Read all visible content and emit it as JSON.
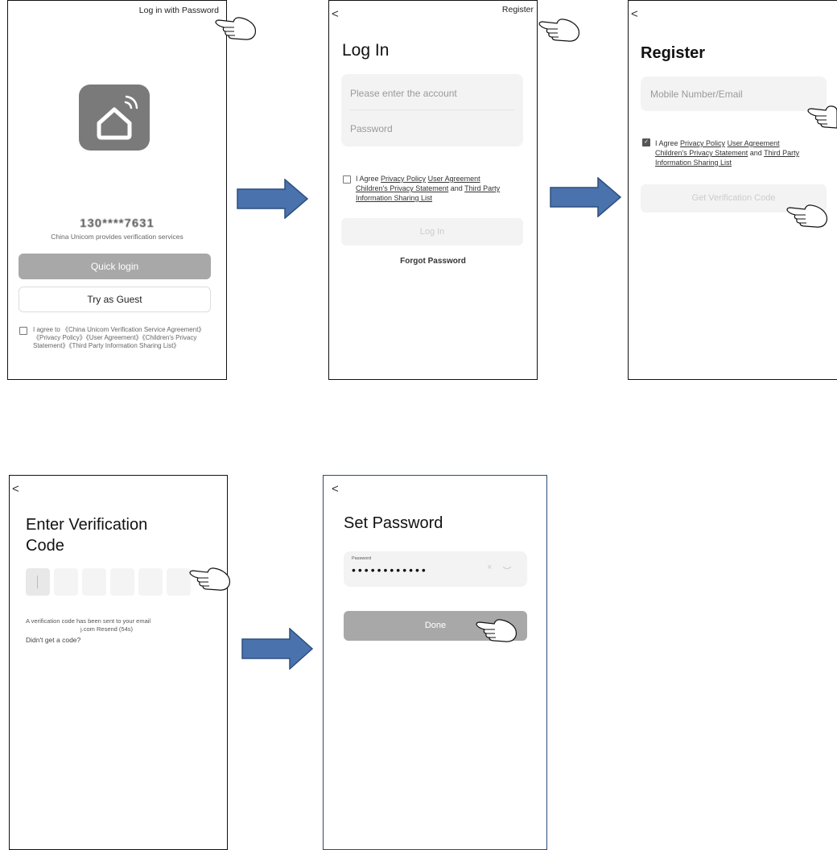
{
  "screen1": {
    "top_link": "Log in with Password",
    "phone_masked": "130****7631",
    "provider_text": "China Unicom provides verification services",
    "quick_login": "Quick login",
    "guest": "Try as Guest",
    "agreement": "I agree to 《China Unicom Verification Service Agreement》《Privacy Policy》《User Agreement》《Children's Privacy Statement》《Third Party Information Sharing List》"
  },
  "screen2": {
    "back": "<",
    "register_link": "Register",
    "title": "Log In",
    "account_placeholder": "Please enter the account",
    "password_placeholder": "Password",
    "agree_prefix": "I Agree",
    "privacy": "Privacy Policy",
    "user_agreement": "User Agreement",
    "children": "Children's Privacy Statement",
    "and": "and",
    "third_party": "Third Party",
    "sharing": "Information Sharing List",
    "login_button": "Log In",
    "forgot": "Forgot Password"
  },
  "screen3": {
    "back": "<",
    "title": "Register",
    "input_placeholder": "Mobile Number/Email",
    "agree_prefix": "I Agree",
    "privacy": "Privacy Policy",
    "user_agreement": "User Agreement",
    "children": "Children's Privacy Statement",
    "and": "and",
    "third_party": "Third Party",
    "sharing": "Information Sharing List",
    "get_code": "Get Verification Code"
  },
  "screen4": {
    "back": "<",
    "title_line1": "Enter Verification",
    "title_line2": "Code",
    "sent_text": "A verification code has been sent to your email",
    "email_tail": "j.com Resend (54s)",
    "no_code": "Didn't get a code?"
  },
  "screen5": {
    "back": "<",
    "title": "Set Password",
    "field_label": "Password",
    "password_mask": "••••••••••••",
    "done": "Done"
  },
  "icons": [
    "home-wifi-icon",
    "right-arrow-icon",
    "pointing-hand-icon",
    "clear-icon",
    "eye-closed-icon"
  ],
  "colors": {
    "arrow_fill": "#4a72ad",
    "arrow_stroke": "#2e4f7e",
    "button_gray": "#a8a8a8",
    "field_bg": "#f3f3f3"
  }
}
